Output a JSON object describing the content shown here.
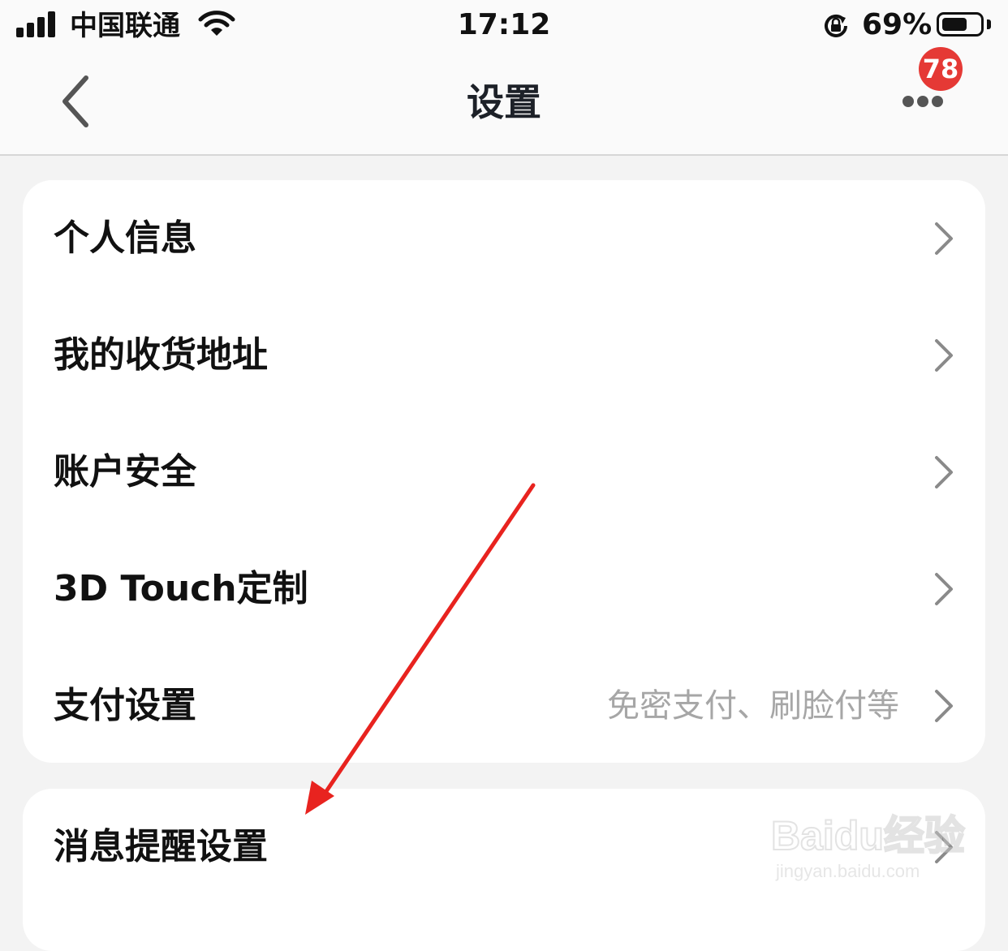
{
  "status_bar": {
    "carrier": "中国联通",
    "time": "17:12",
    "battery_percent": "69%",
    "battery_level": 0.69,
    "icons": [
      "signal-icon",
      "wifi-icon",
      "rotation-lock-icon",
      "battery-icon"
    ]
  },
  "nav": {
    "title": "设置",
    "back_icon": "chevron-left-icon",
    "more_icon": "more-dots-icon",
    "badge_count": "78",
    "badge_color": "#e53935"
  },
  "settings_group_1": [
    {
      "label": "个人信息",
      "hint": ""
    },
    {
      "label": "我的收货地址",
      "hint": ""
    },
    {
      "label": "账户安全",
      "hint": ""
    },
    {
      "label": "3D Touch定制",
      "hint": ""
    },
    {
      "label": "支付设置",
      "hint": "免密支付、刷脸付等"
    }
  ],
  "settings_group_2": [
    {
      "label": "消息提醒设置",
      "hint": ""
    }
  ],
  "annotation": {
    "type": "red-arrow",
    "color": "#e8231f",
    "points_to": "消息提醒设置"
  },
  "watermark": {
    "brand": "Baidu经验",
    "url": "jingyan.baidu.com"
  }
}
